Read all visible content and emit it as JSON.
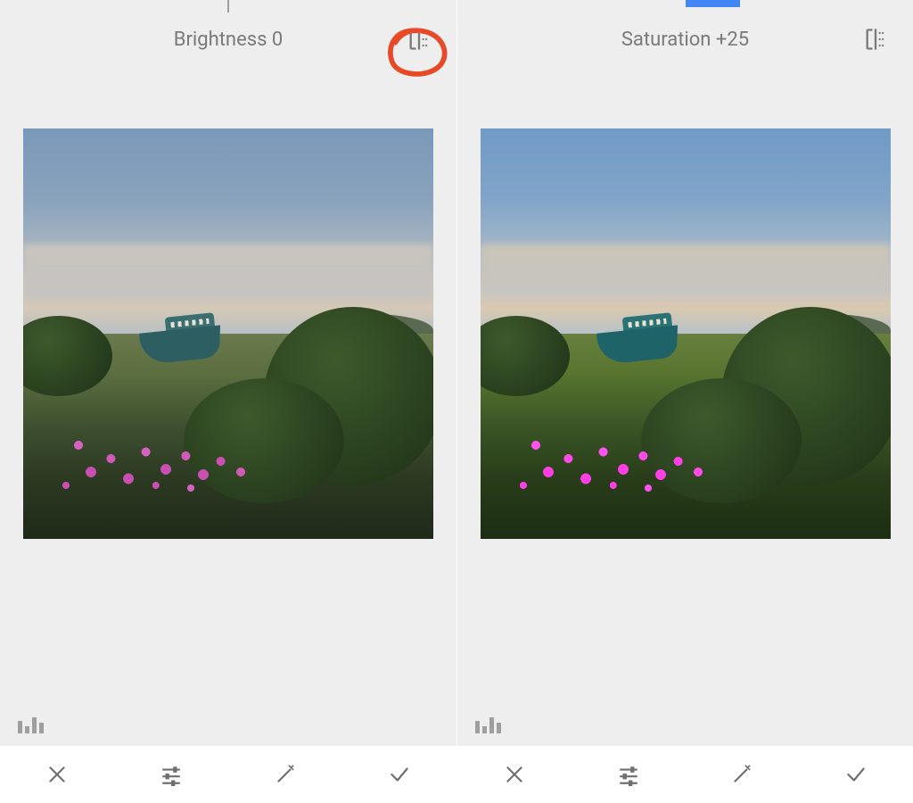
{
  "panels": [
    {
      "slider": {
        "center_tick": true,
        "fill_percent": 0
      },
      "label": "Brightness 0",
      "annotated": true,
      "saturated": false
    },
    {
      "slider": {
        "center_tick": false,
        "fill_percent": 12
      },
      "label": "Saturation +25",
      "annotated": false,
      "saturated": true
    }
  ],
  "icons": {
    "compare": "compare-icon",
    "histogram": "histogram-icon",
    "cancel": "close-icon",
    "adjust": "adjust-sliders-icon",
    "wand": "magic-wand-icon",
    "apply": "checkmark-icon"
  }
}
